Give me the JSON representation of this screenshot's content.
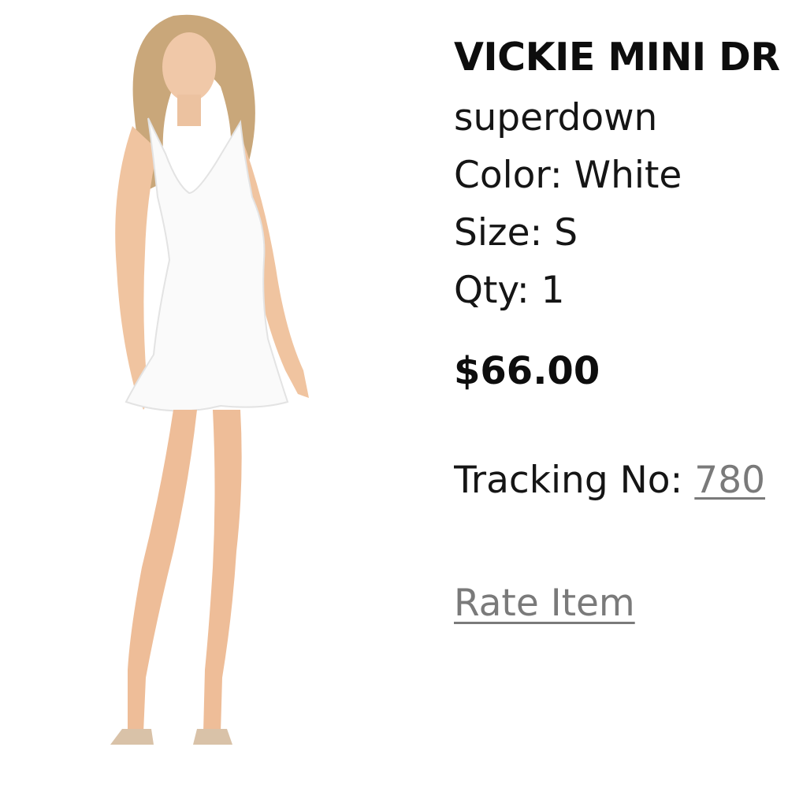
{
  "product": {
    "image_name": "product-photo-white-dress",
    "title": "VICKIE MINI DR",
    "brand": "superdown",
    "color_line": "Color: White",
    "size_line": "Size: S",
    "qty_line": "Qty: 1",
    "price": "$66.00"
  },
  "tracking": {
    "label": "Tracking No: ",
    "number": "780"
  },
  "actions": {
    "rate_item": "Rate Item"
  }
}
